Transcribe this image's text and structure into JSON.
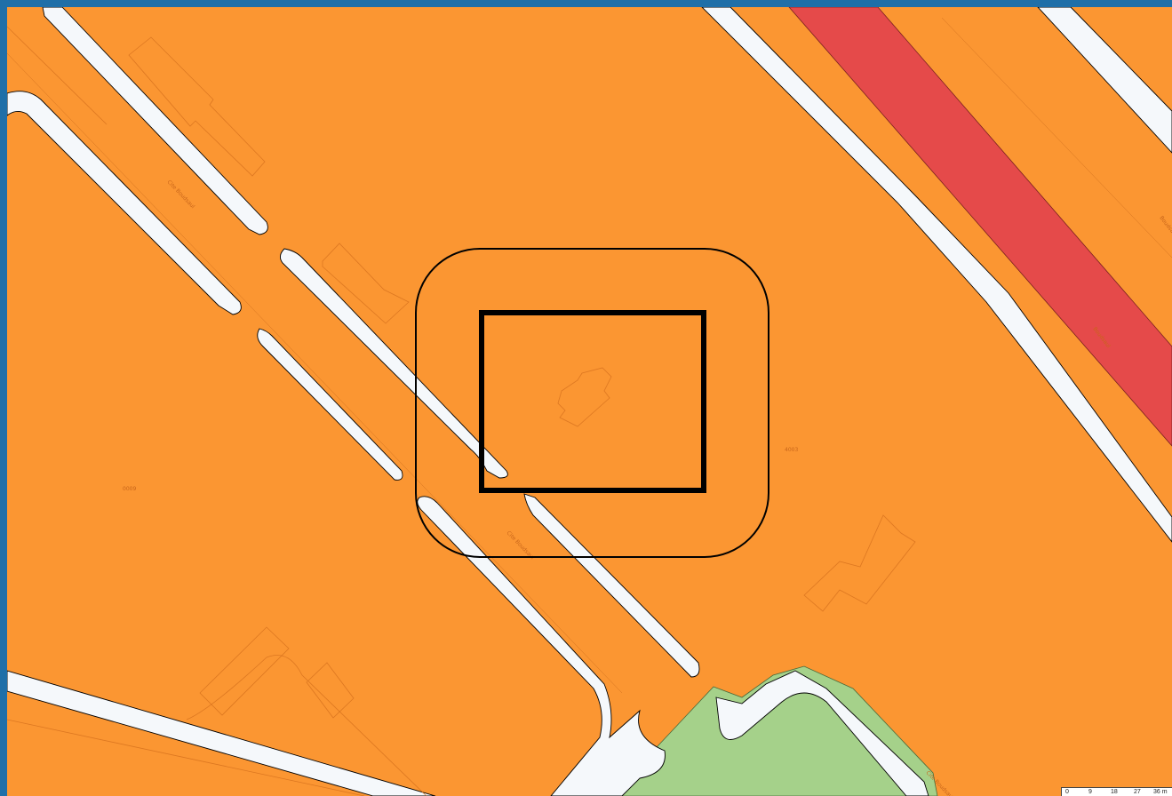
{
  "colors": {
    "zone_orange": "#fb9632",
    "zone_red": "#e54a4a",
    "zone_green": "#a5d18a",
    "road_white": "#f5f8fb",
    "outline": "#000000",
    "building_outline": "#d7721e",
    "frame_border": "#1f6fa8"
  },
  "labels": {
    "road_name_1": "Cite Boudsaul",
    "road_name_2": "Cite Boudsaul",
    "road_name_3": "Cite Boudsaul",
    "road_name_4": "Boudsaul",
    "road_name_5": "Boudsaul",
    "parcel_1": "0009",
    "parcel_2": "4003"
  },
  "scalebar": {
    "ticks": [
      "0",
      "9",
      "18",
      "27",
      "36 m"
    ]
  },
  "icons": {
    "selection_outer": "rounded-rectangle",
    "selection_inner": "rectangle"
  }
}
